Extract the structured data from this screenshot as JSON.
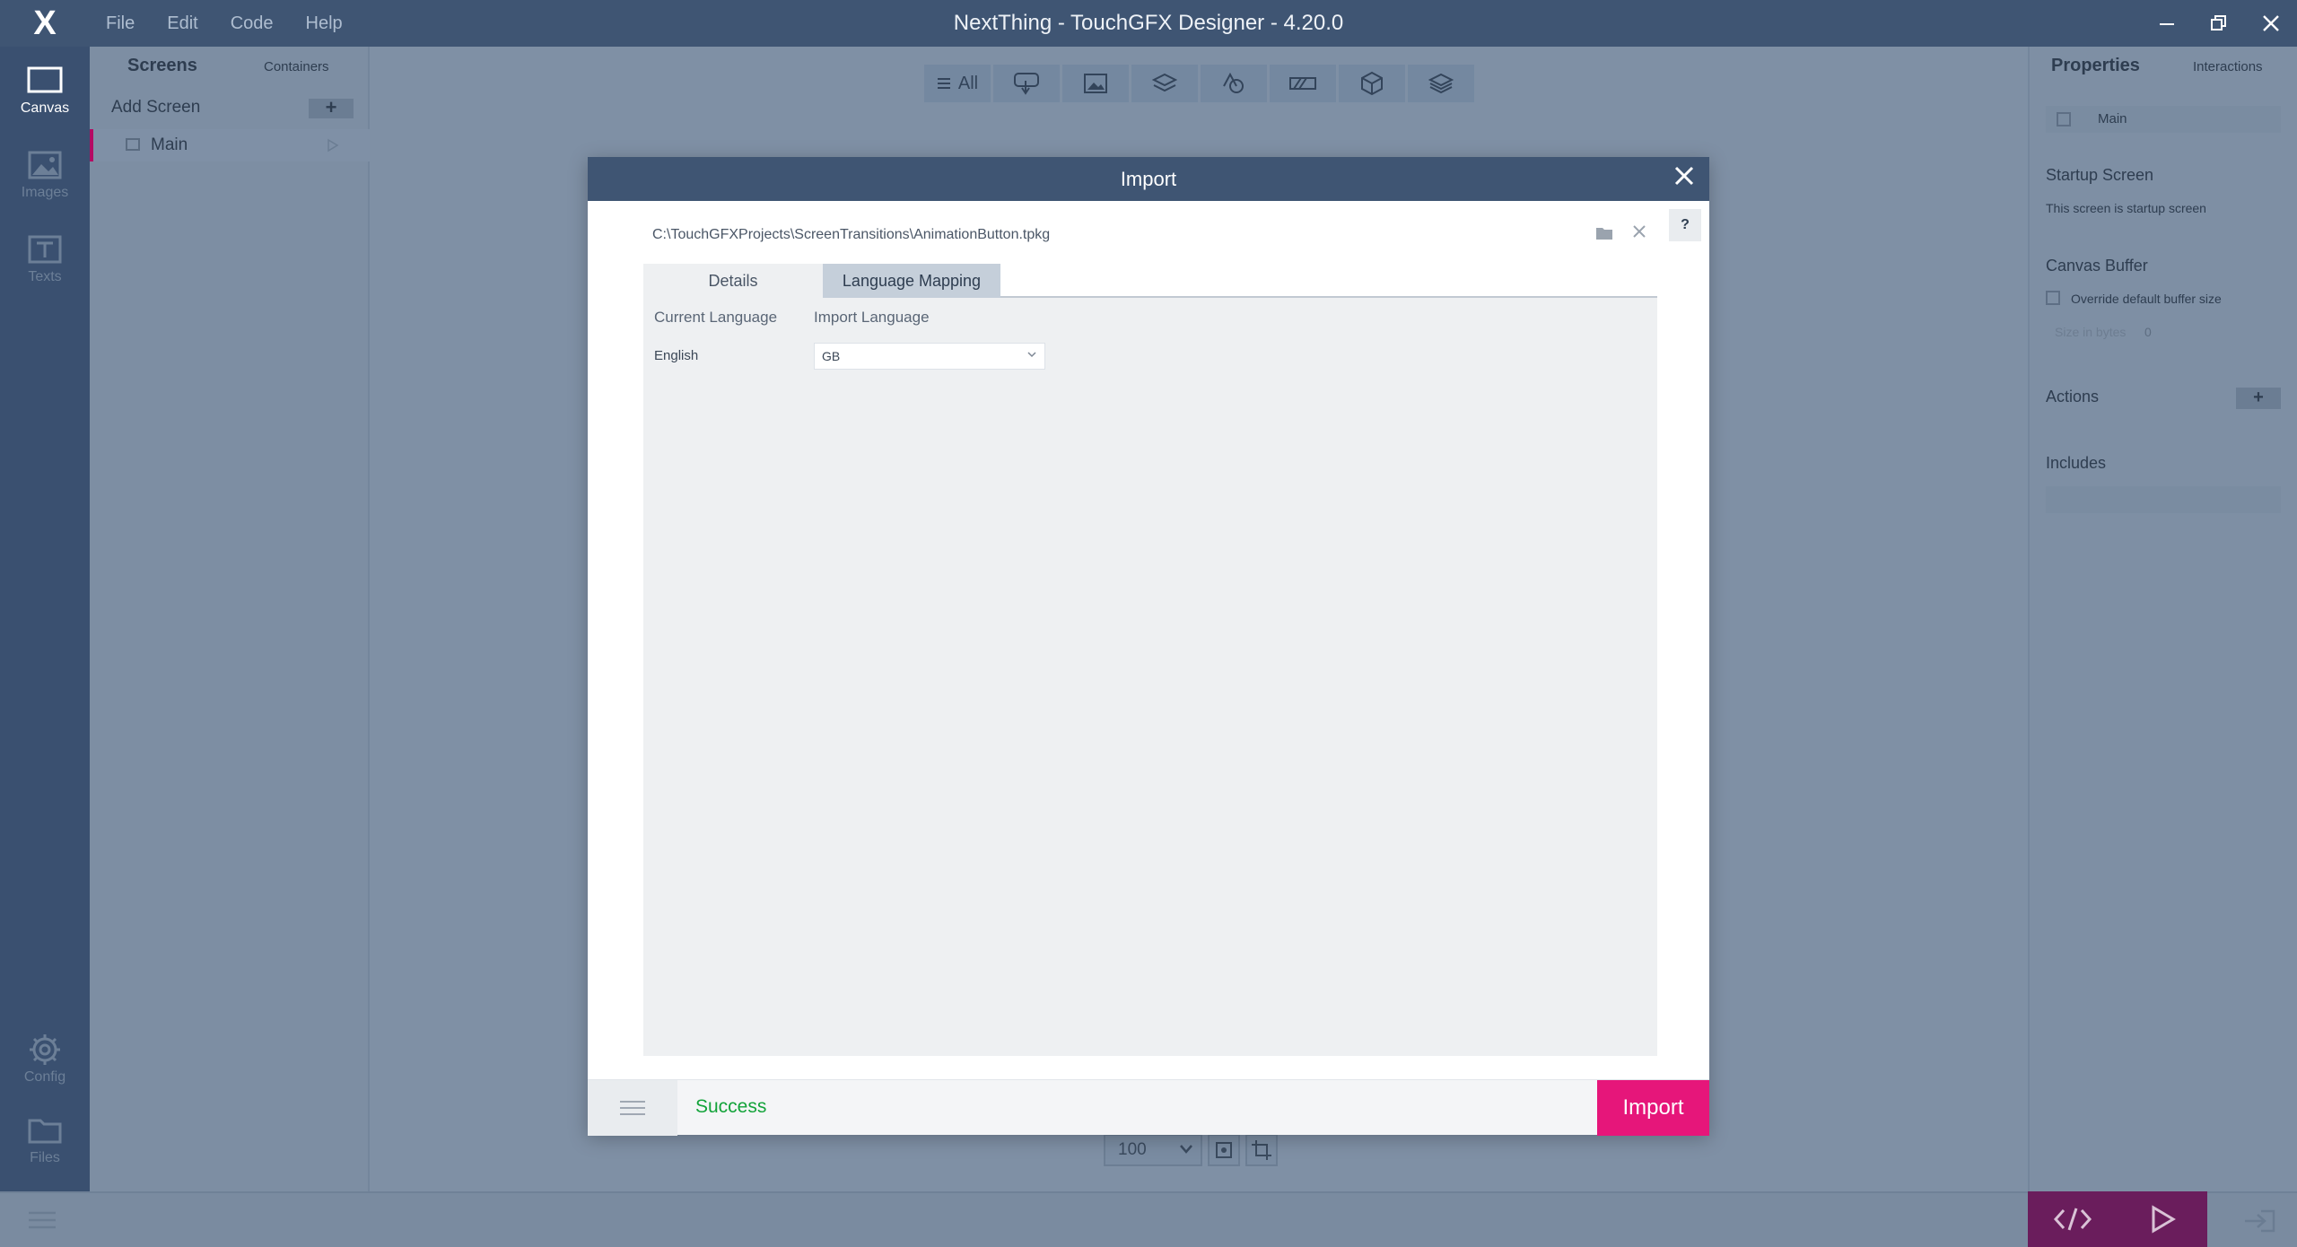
{
  "app": {
    "title": "NextThing - TouchGFX Designer - 4.20.0",
    "logo": "X",
    "menu": [
      "File",
      "Edit",
      "Code",
      "Help"
    ]
  },
  "rail": {
    "items": [
      {
        "label": "Canvas",
        "icon": "canvas-icon"
      },
      {
        "label": "Images",
        "icon": "images-icon"
      },
      {
        "label": "Texts",
        "icon": "texts-icon"
      },
      {
        "label": "Config",
        "icon": "gear-icon"
      },
      {
        "label": "Files",
        "icon": "folder-icon"
      }
    ]
  },
  "screens_panel": {
    "tab_screens": "Screens",
    "tab_containers": "Containers",
    "add_screen": "Add Screen",
    "add_symbol": "+",
    "items": [
      {
        "label": "Main"
      }
    ]
  },
  "toolbar": {
    "all_label": "All"
  },
  "zoom": {
    "value": "100"
  },
  "properties": {
    "tab_properties": "Properties",
    "tab_interactions": "Interactions",
    "screen_name": "Main",
    "startup_title": "Startup Screen",
    "startup_text": "This screen is startup screen",
    "canvas_buffer_title": "Canvas Buffer",
    "override_label": "Override default buffer size",
    "size_label": "Size in bytes",
    "size_value": "0",
    "actions_title": "Actions",
    "actions_add": "+",
    "includes_title": "Includes"
  },
  "dialog": {
    "title": "Import",
    "help": "?",
    "path": "C:\\TouchGFXProjects\\ScreenTransitions\\AnimationButton.tpkg",
    "tabs": [
      "Details",
      "Language Mapping"
    ],
    "active_tab": "Language Mapping",
    "col_current": "Current Language",
    "col_import": "Import Language",
    "row_current": "English",
    "row_import": "GB",
    "status": "Success",
    "import_label": "Import",
    "colors": {
      "accent": "#e6167a",
      "success": "#13a33a",
      "header": "#3f5573"
    }
  }
}
